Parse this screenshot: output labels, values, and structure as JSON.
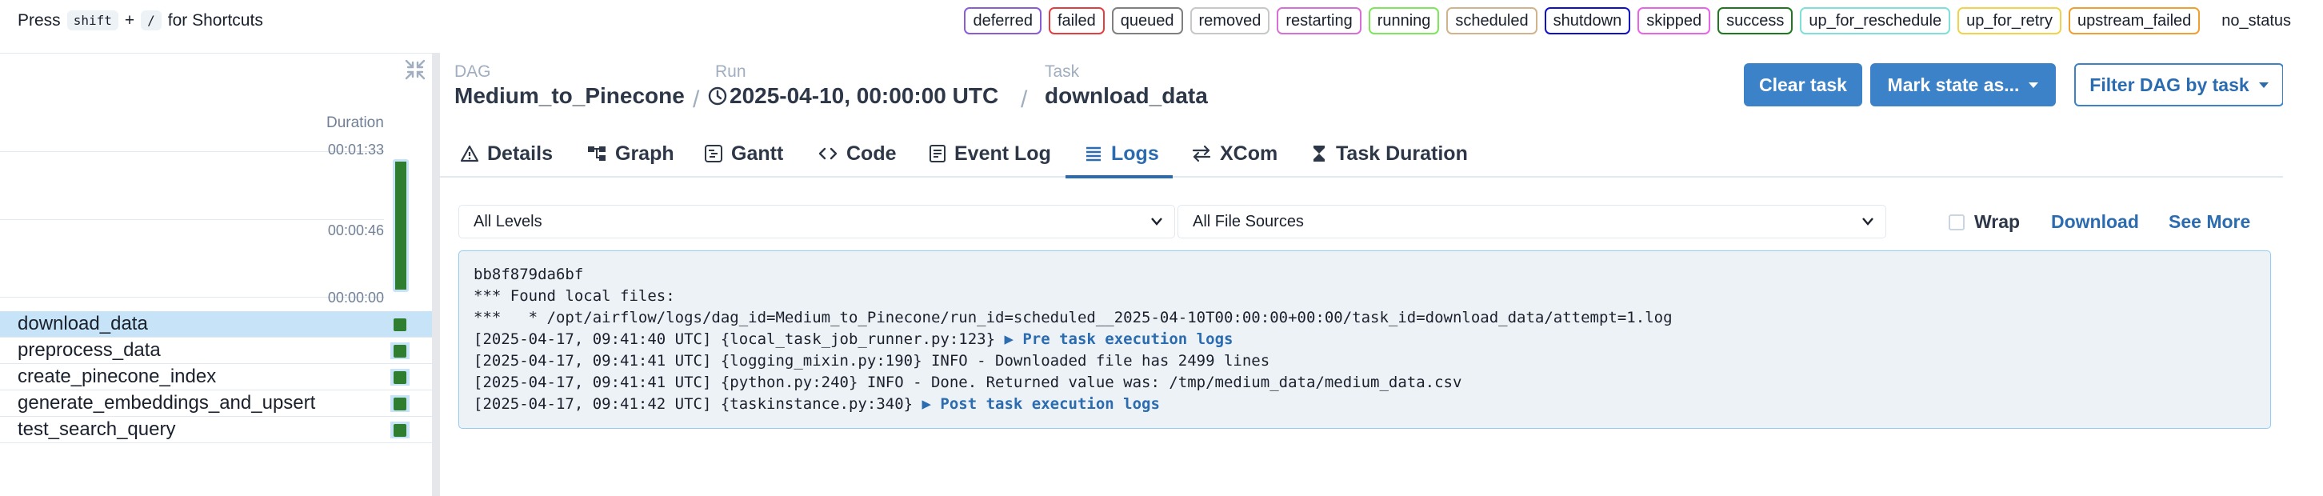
{
  "topbar": {
    "hint_prefix": "Press",
    "hint_key1": "shift",
    "hint_plus": "+",
    "hint_key2": "/",
    "hint_suffix": "for Shortcuts",
    "legend": [
      {
        "label": "deferred",
        "color": "#8a5cd6"
      },
      {
        "label": "failed",
        "color": "#e53e3e"
      },
      {
        "label": "queued",
        "color": "#808080"
      },
      {
        "label": "removed",
        "color": "#c8c8c8"
      },
      {
        "label": "restarting",
        "color": "#d670d6"
      },
      {
        "label": "running",
        "color": "#7ee65c"
      },
      {
        "label": "scheduled",
        "color": "#d2b48c"
      },
      {
        "label": "shutdown",
        "color": "#1010c8"
      },
      {
        "label": "skipped",
        "color": "#e865e8"
      },
      {
        "label": "success",
        "color": "#1f7a1f"
      },
      {
        "label": "up_for_reschedule",
        "color": "#7fe0d8"
      },
      {
        "label": "up_for_retry",
        "color": "#f2d24a"
      },
      {
        "label": "upstream_failed",
        "color": "#f0a030"
      },
      {
        "label": "no_status",
        "color": "transparent"
      }
    ]
  },
  "grid": {
    "duration_label": "Duration",
    "ticks": [
      "00:01:33",
      "00:00:46",
      "00:00:00"
    ],
    "success_color": "#2f7d2f",
    "tasks": [
      {
        "name": "download_data",
        "selected": true
      },
      {
        "name": "preprocess_data",
        "selected": false
      },
      {
        "name": "create_pinecone_index",
        "selected": false
      },
      {
        "name": "generate_embeddings_and_upsert",
        "selected": false
      },
      {
        "name": "test_search_query",
        "selected": false
      }
    ]
  },
  "breadcrumb": {
    "dag_label": "DAG",
    "dag_value": "Medium_to_Pinecone",
    "run_label": "Run",
    "run_value": "2025-04-10, 00:00:00 UTC",
    "task_label": "Task",
    "task_value": "download_data",
    "separator": "/"
  },
  "actions": {
    "clear_task": "Clear task",
    "mark_state": "Mark state as...",
    "filter_dag": "Filter DAG by task"
  },
  "tabs": [
    {
      "label": "Details",
      "icon": "warning-icon"
    },
    {
      "label": "Graph",
      "icon": "graph-icon"
    },
    {
      "label": "Gantt",
      "icon": "gantt-icon"
    },
    {
      "label": "Code",
      "icon": "code-icon"
    },
    {
      "label": "Event Log",
      "icon": "event-log-icon"
    },
    {
      "label": "Logs",
      "icon": "logs-icon",
      "active": true
    },
    {
      "label": "XCom",
      "icon": "xcom-icon"
    },
    {
      "label": "Task Duration",
      "icon": "hourglass-icon"
    }
  ],
  "log_controls": {
    "level_select": "All Levels",
    "source_select": "All File Sources",
    "wrap_label": "Wrap",
    "download_label": "Download",
    "see_more_label": "See More"
  },
  "log": {
    "lines": [
      {
        "text": "bb8f879da6bf",
        "link": ""
      },
      {
        "text": "*** Found local files:",
        "link": ""
      },
      {
        "text": "***   * /opt/airflow/logs/dag_id=Medium_to_Pinecone/run_id=scheduled__2025-04-10T00:00:00+00:00/task_id=download_data/attempt=1.log",
        "link": ""
      },
      {
        "text": "[2025-04-17, 09:41:40 UTC] {local_task_job_runner.py:123} ",
        "link": "▶ Pre task execution logs"
      },
      {
        "text": "[2025-04-17, 09:41:41 UTC] {logging_mixin.py:190} INFO - Downloaded file has 2499 lines",
        "link": ""
      },
      {
        "text": "[2025-04-17, 09:41:41 UTC] {python.py:240} INFO - Done. Returned value was: /tmp/medium_data/medium_data.csv",
        "link": ""
      },
      {
        "text": "[2025-04-17, 09:41:42 UTC] {taskinstance.py:340} ",
        "link": "▶ Post task execution logs"
      }
    ]
  }
}
